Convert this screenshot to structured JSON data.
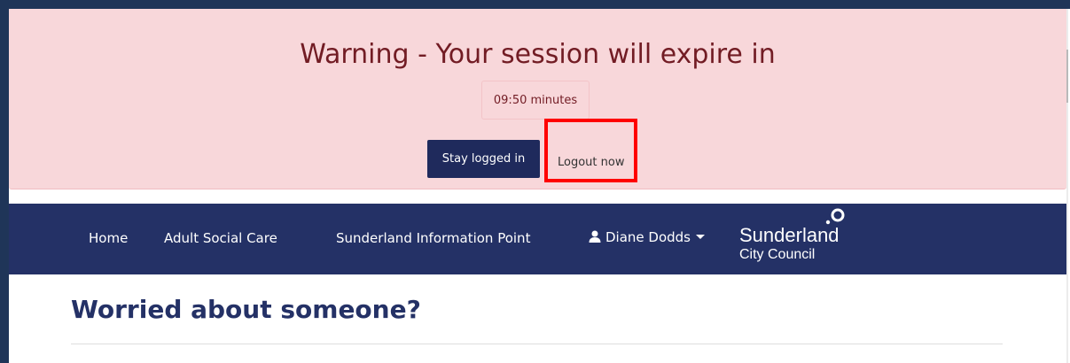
{
  "warning": {
    "title": "Warning - Your session will expire in",
    "countdown": "09:50 minutes",
    "stay_label": "Stay logged in",
    "logout_label": "Logout now"
  },
  "nav": {
    "items": [
      {
        "label": "Home"
      },
      {
        "label": "Adult Social Care"
      },
      {
        "label": "Sunderland Information Point"
      }
    ],
    "user": {
      "name": "Diane Dodds",
      "icon": "user-icon"
    },
    "logo": {
      "line1": "Sunderland",
      "line2": "City Council"
    }
  },
  "page": {
    "title": "Worried about someone?"
  },
  "colors": {
    "warning_bg": "#f8d7da",
    "warning_text": "#721c24",
    "nav_bg": "#243166",
    "primary_button": "#1f2a5c",
    "highlight": "#ff0000",
    "heading": "#243166"
  }
}
